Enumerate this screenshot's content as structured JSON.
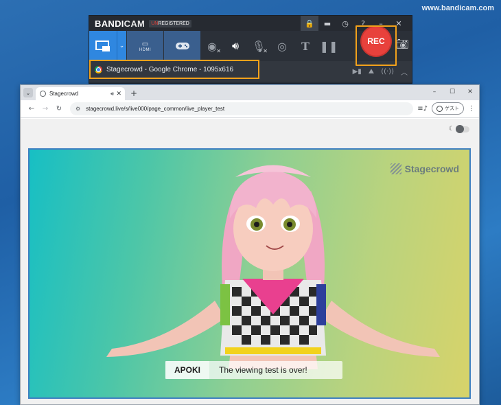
{
  "watermark": "www.bandicam.com",
  "bandicam": {
    "logo_main": "BANDI",
    "logo_cam": "CAM",
    "unregistered_u": "UN",
    "unregistered_rest": "REGISTERED",
    "title_icons": [
      "lock-icon",
      "folder-icon",
      "clock-icon",
      "help-icon",
      "minimize-icon",
      "close-icon"
    ],
    "mode_hdmi_label": "HDMI",
    "rec_label": "REC",
    "target_text": "Stagecrowd - Google Chrome - 1095x616"
  },
  "chrome": {
    "tab_title": "Stagecrowd",
    "url": "stagecrowd.live/s/live000/page_common/live_player_test",
    "guest_label": "ゲスト"
  },
  "player": {
    "brand": "Stagecrowd",
    "caption_name": "APOKI",
    "caption_text": "The viewing test is over!"
  },
  "colors": {
    "rec": "#e8413c",
    "highlight": "#f3a21b",
    "bandicam_blue": "#2f87e0"
  }
}
